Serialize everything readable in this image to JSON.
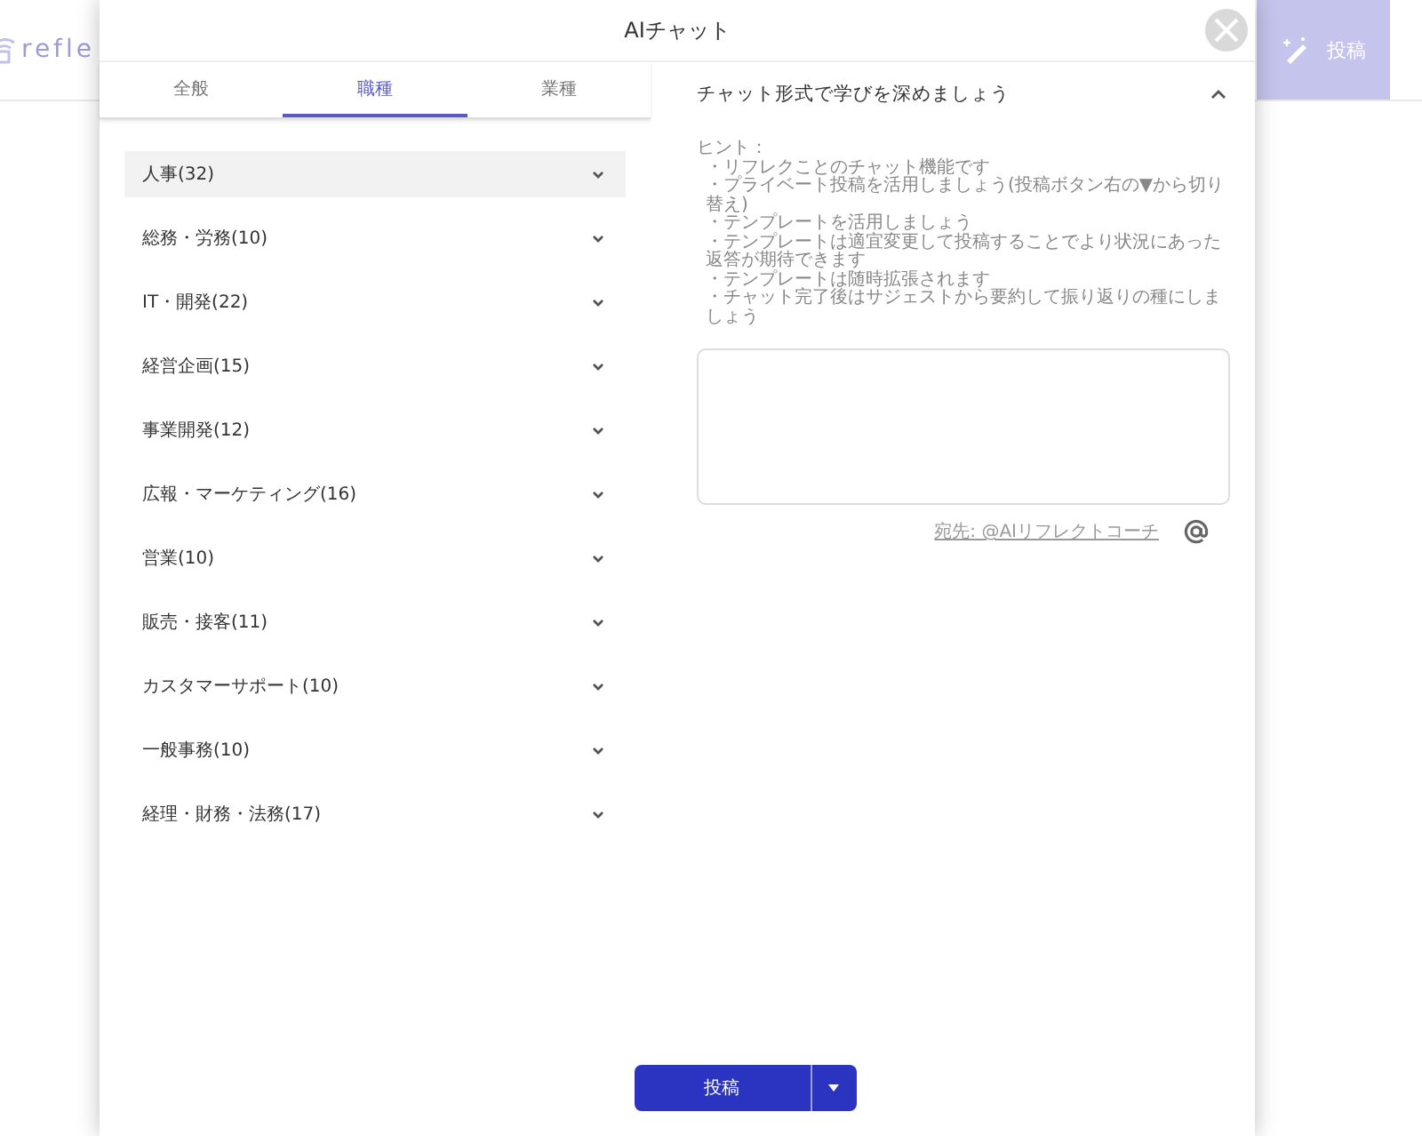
{
  "background": {
    "logo": "refle",
    "post_button": "投稿"
  },
  "modal": {
    "title": "AIチャット",
    "tabs": [
      {
        "label": "全般",
        "selected": false
      },
      {
        "label": "職種",
        "selected": true
      },
      {
        "label": "業種",
        "selected": false
      }
    ],
    "categories": [
      {
        "label": "人事(32)",
        "selected": true
      },
      {
        "label": "総務・労務(10)",
        "selected": false
      },
      {
        "label": "IT・開発(22)",
        "selected": false
      },
      {
        "label": "経営企画(15)",
        "selected": false
      },
      {
        "label": "事業開発(12)",
        "selected": false
      },
      {
        "label": "広報・マーケティング(16)",
        "selected": false
      },
      {
        "label": "営業(10)",
        "selected": false
      },
      {
        "label": "販売・接客(11)",
        "selected": false
      },
      {
        "label": "カスタマーサポート(10)",
        "selected": false
      },
      {
        "label": "一般事務(10)",
        "selected": false
      },
      {
        "label": "経理・財務・法務(17)",
        "selected": false
      }
    ],
    "panel": {
      "heading": "チャット形式で学びを深めましょう",
      "expanded": true,
      "hint_label": "ヒント：",
      "hints": [
        "・リフレクことのチャット機能です",
        "・プライベート投稿を活用しましょう(投稿ボタン右の▼から切り替え)",
        "・テンプレートを活用しましょう",
        "・テンプレートは適宜変更して投稿することでより状況にあった返答が期待できます",
        "・テンプレートは随時拡張されます",
        "・チャット完了後はサジェストから要約して振り返りの種にしましょう"
      ],
      "recipient": "宛先: @AIリフレクトコーチ"
    },
    "submit": "投稿"
  }
}
